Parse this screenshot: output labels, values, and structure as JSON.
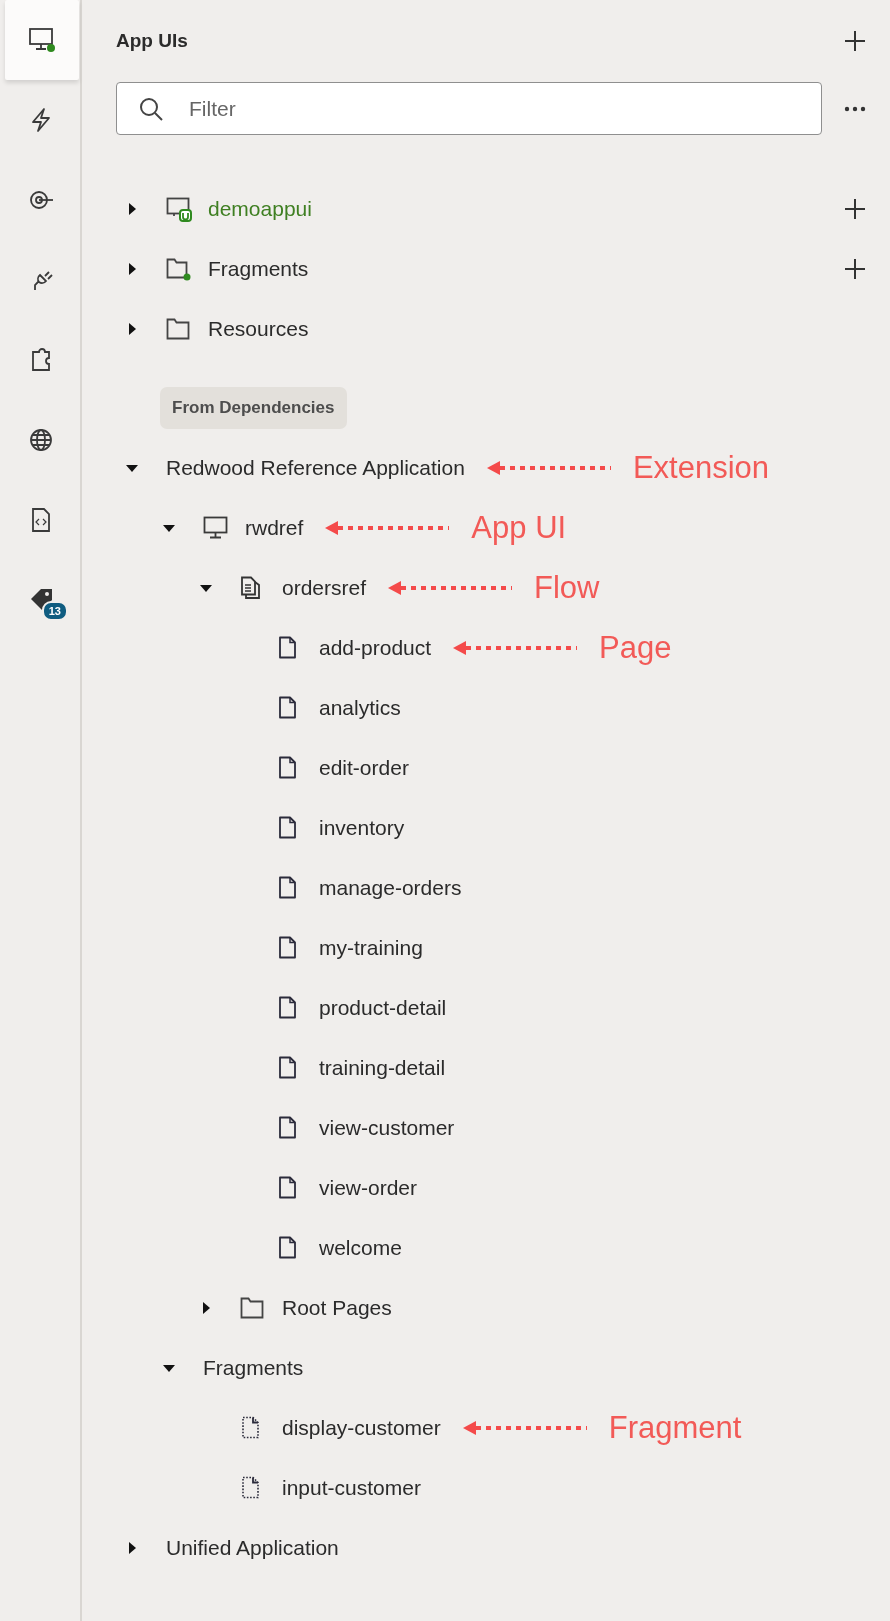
{
  "rail": [
    {
      "kind": "monitor",
      "selected": true
    },
    {
      "kind": "bolt",
      "selected": false
    },
    {
      "kind": "target",
      "selected": false
    },
    {
      "kind": "plug",
      "selected": false
    },
    {
      "kind": "puzzle",
      "selected": false
    },
    {
      "kind": "globe",
      "selected": false
    },
    {
      "kind": "code-file",
      "selected": false
    },
    {
      "kind": "tag",
      "selected": false,
      "badge": "13"
    }
  ],
  "panel": {
    "title": "App UIs",
    "search": {
      "placeholder": "Filter"
    }
  },
  "tree": [
    {
      "kind": "local_app_ui",
      "label": "demoappui",
      "expanded": false,
      "addable": true
    },
    {
      "kind": "fragments_folder",
      "label": "Fragments",
      "expanded": false,
      "addable": true
    },
    {
      "kind": "folder",
      "label": "Resources",
      "expanded": false,
      "addable": false
    }
  ],
  "dependencies": {
    "label": "From Dependencies",
    "tree": [
      {
        "label": "Redwood Reference Application",
        "expanded": true,
        "annotation": "Extension",
        "children": [
          {
            "kind": "app_ui",
            "label": "rwdref",
            "expanded": true,
            "annotation": "App UI",
            "children": [
              {
                "kind": "flow",
                "label": "ordersref",
                "expanded": true,
                "annotation": "Flow",
                "children": [
                  {
                    "kind": "page",
                    "label": "add-product",
                    "annotation": "Page"
                  },
                  {
                    "kind": "page",
                    "label": "analytics"
                  },
                  {
                    "kind": "page",
                    "label": "edit-order"
                  },
                  {
                    "kind": "page",
                    "label": "inventory"
                  },
                  {
                    "kind": "page",
                    "label": "manage-orders"
                  },
                  {
                    "kind": "page",
                    "label": "my-training"
                  },
                  {
                    "kind": "page",
                    "label": "product-detail"
                  },
                  {
                    "kind": "page",
                    "label": "training-detail"
                  },
                  {
                    "kind": "page",
                    "label": "view-customer"
                  },
                  {
                    "kind": "page",
                    "label": "view-order"
                  },
                  {
                    "kind": "page",
                    "label": "welcome"
                  }
                ]
              },
              {
                "kind": "folder",
                "label": "Root Pages",
                "expanded": false
              }
            ]
          },
          {
            "label": "Fragments",
            "expanded": true,
            "children": [
              {
                "kind": "fragment",
                "label": "display-customer",
                "annotation": "Fragment"
              },
              {
                "kind": "fragment",
                "label": "input-customer"
              }
            ]
          }
        ]
      },
      {
        "label": "Unified Application",
        "expanded": false
      }
    ]
  }
}
